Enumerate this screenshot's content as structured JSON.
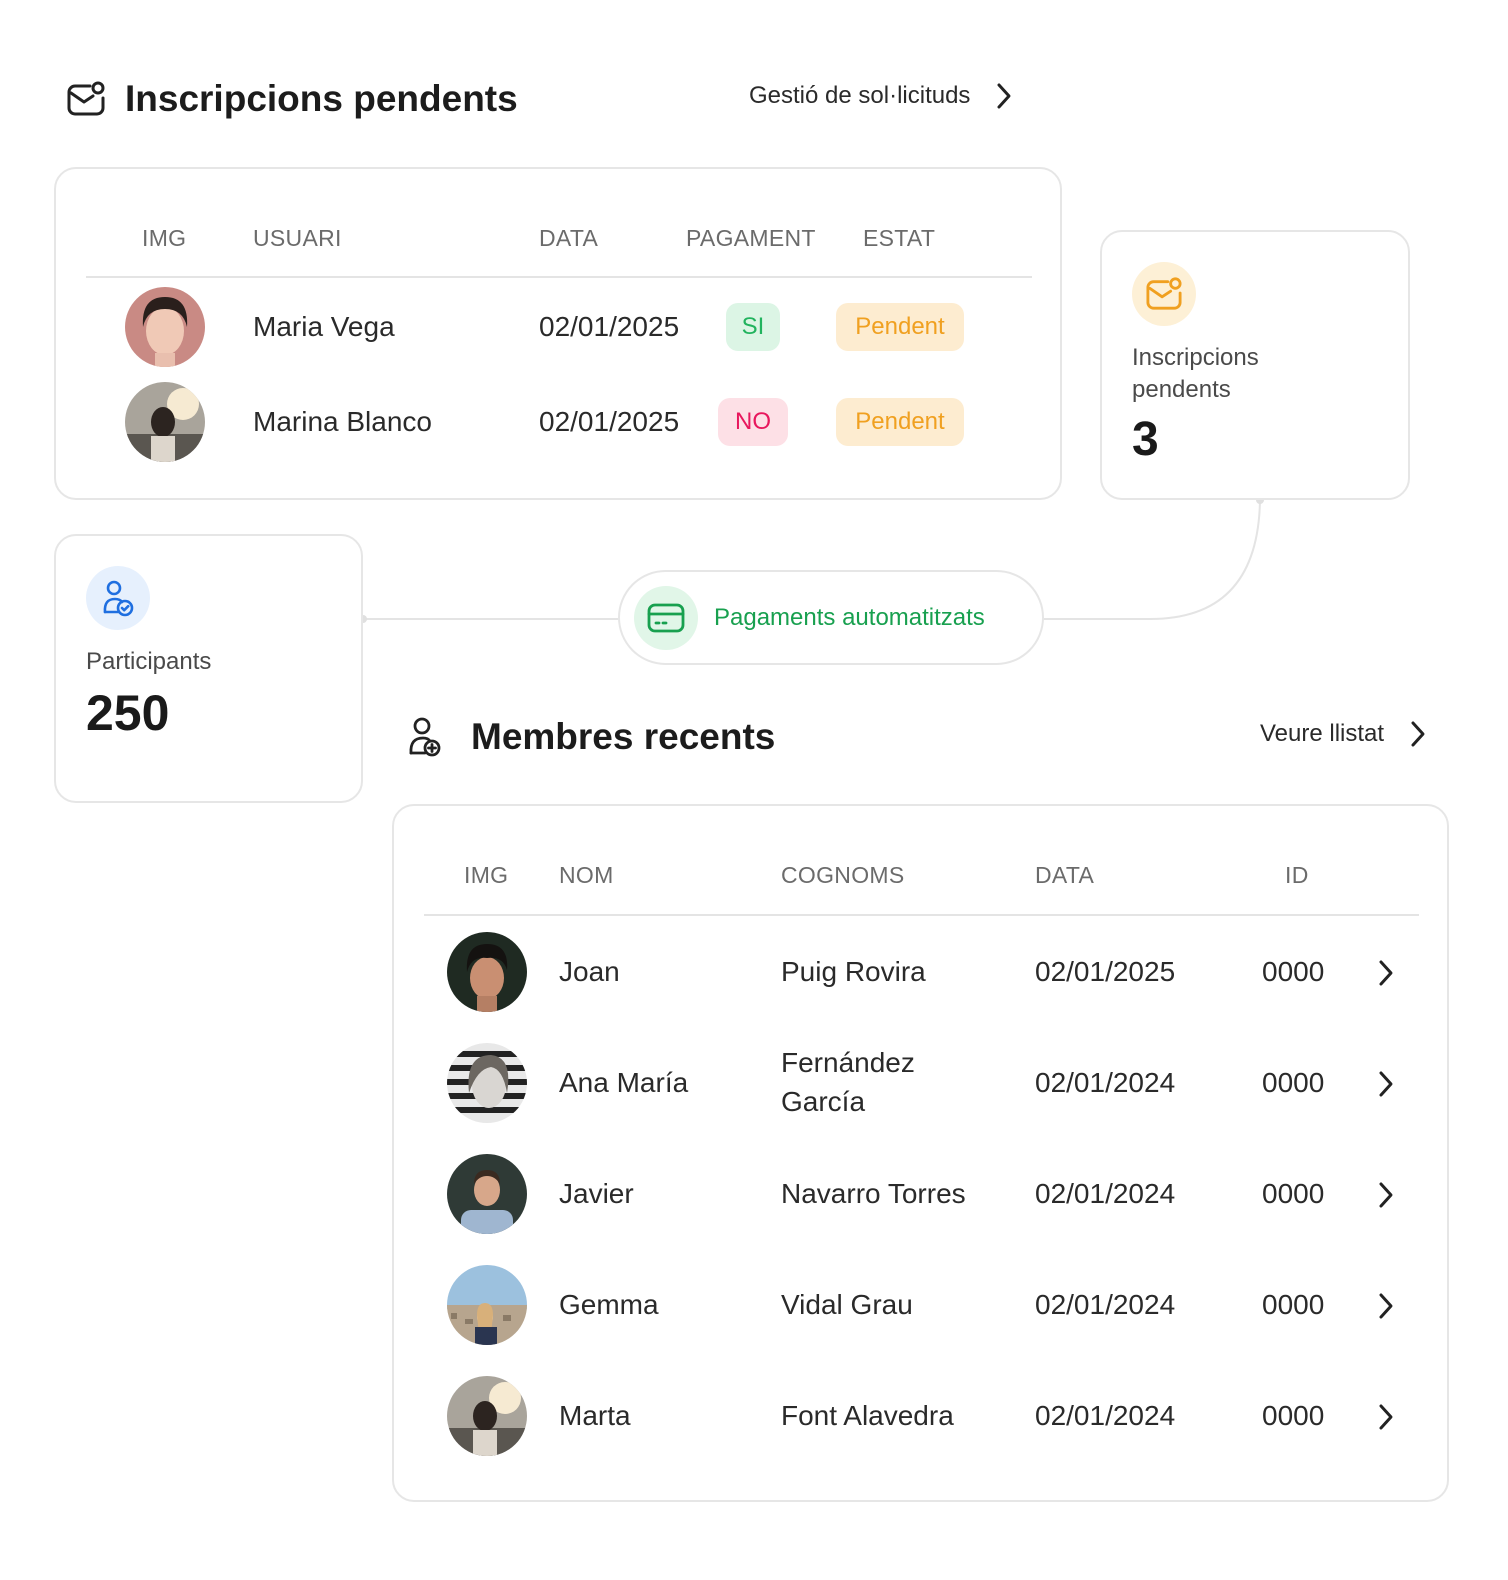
{
  "pending": {
    "title": "Inscripcions pendents",
    "link_label": "Gestió de sol·licituds",
    "headers": {
      "img": "IMG",
      "user": "USUARI",
      "date": "DATA",
      "payment": "PAGAMENT",
      "status": "ESTAT"
    },
    "rows": [
      {
        "user": "Maria Vega",
        "date": "02/01/2025",
        "payment": "SI",
        "status": "Pendent"
      },
      {
        "user": "Marina Blanco",
        "date": "02/01/2025",
        "payment": "NO",
        "status": "Pendent"
      }
    ]
  },
  "pending_stat": {
    "label": "Inscripcions pendents",
    "value": "3"
  },
  "participants_stat": {
    "label": "Participants",
    "value": "250"
  },
  "payments_pill": {
    "label": "Pagaments automatitzats"
  },
  "members": {
    "title": "Membres recents",
    "link_label": "Veure llistat",
    "headers": {
      "img": "IMG",
      "name": "NOM",
      "surname": "COGNOMS",
      "date": "DATA",
      "id": "ID"
    },
    "rows": [
      {
        "name": "Joan",
        "surname": "Puig Rovira",
        "date": "02/01/2025",
        "id": "0000"
      },
      {
        "name": "Ana María",
        "surname_line1": "Fernández",
        "surname_line2": "García",
        "date": "02/01/2024",
        "id": "0000"
      },
      {
        "name": "Javier",
        "surname": "Navarro Torres",
        "date": "02/01/2024",
        "id": "0000"
      },
      {
        "name": "Gemma",
        "surname": "Vidal Grau",
        "date": "02/01/2024",
        "id": "0000"
      },
      {
        "name": "Marta",
        "surname": "Font Alavedra",
        "date": "02/01/2024",
        "id": "0000"
      }
    ]
  },
  "colors": {
    "accent_green": "#18a04f",
    "badge_yes": "#22b35e",
    "badge_no": "#e8175d",
    "badge_pending": "#f0a020",
    "participants_icon": "#1f6fe0"
  },
  "icons": {
    "pending_section": "mail-notification-icon",
    "members_section": "user-add-icon",
    "chevron": "chevron-right-icon",
    "payments": "credit-card-icon",
    "participants": "user-check-icon"
  }
}
